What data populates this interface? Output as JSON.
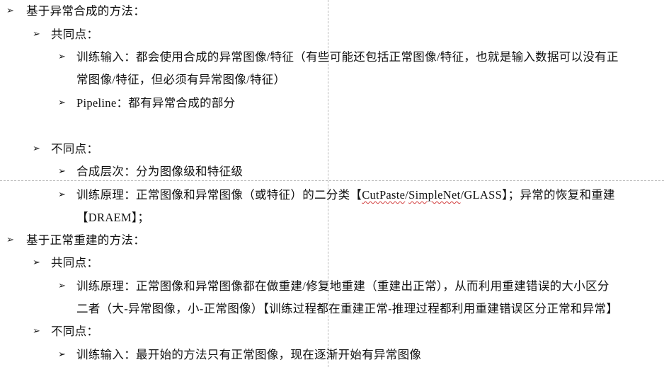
{
  "bullet_glyph": "➢",
  "sections": [
    {
      "title": "基于异常合成的方法：",
      "common": {
        "label": "共同点：",
        "items": [
          {
            "line1": "训练输入：都会使用合成的异常图像/特征（有些可能还包括正常图像/特征，也就是输入数据可以没有正",
            "line2": "常图像/特征，但必须有异常图像/特征）"
          },
          {
            "line1": "Pipeline：都有异常合成的部分"
          }
        ]
      },
      "diff": {
        "label": "不同点：",
        "items": [
          {
            "line1": "合成层次：分为图像级和特征级"
          },
          {
            "line1_a": "训练原理：正常图像和异常图像（或特征）的二分类【",
            "link1": "CutPaste",
            "sep1": "/",
            "link2": "SimpleNet",
            "line1_b": "/GLASS】；异常的恢复和重建",
            "line2": "【DRAEM】；"
          }
        ]
      }
    },
    {
      "title": "基于正常重建的方法：",
      "common": {
        "label": "共同点：",
        "items": [
          {
            "line1": "训练原理：正常图像和异常图像都在做重建/修复地重建（重建出正常），从而利用重建错误的大小区分",
            "line2": "二者（大-异常图像，小-正常图像）【训练过程都在重建正常-推理过程都利用重建错误区分正常和异常】"
          }
        ]
      },
      "diff": {
        "label": "不同点：",
        "items": [
          {
            "line1": "训练输入：最开始的方法只有正常图像，现在逐渐开始有异常图像"
          }
        ]
      }
    }
  ]
}
